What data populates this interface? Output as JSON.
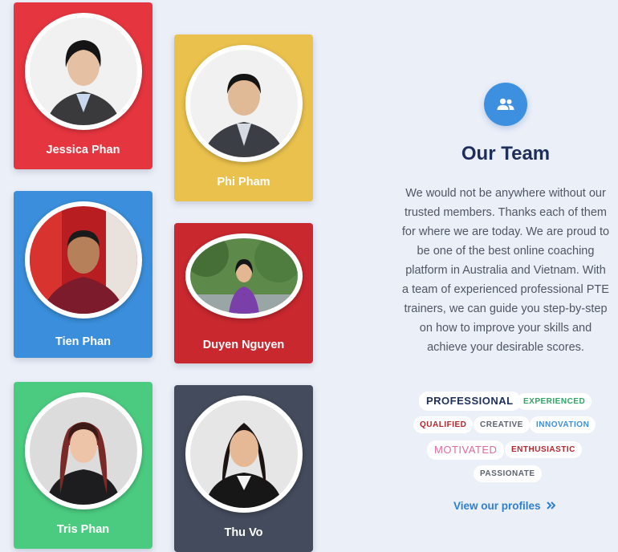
{
  "members": [
    {
      "name": "Jessica Phan",
      "color": "#e5353f"
    },
    {
      "name": "Phi Pham",
      "color": "#eac14c"
    },
    {
      "name": "Tien Phan",
      "color": "#3a8edb"
    },
    {
      "name": "Duyen Nguyen",
      "color": "#c8282e"
    },
    {
      "name": "Tris Phan",
      "color": "#4bcb80"
    },
    {
      "name": "Thu Vo",
      "color": "#434b5c"
    }
  ],
  "team": {
    "icon": "users-icon",
    "title": "Our Team",
    "description": "We would not be anywhere without our trusted members. Thanks each of them for where we are today. We are proud to be one of the best online coaching platform in Australia and Vietnam. With a team of experienced professional PTE trainers, we can guide you step-by-step on how to improve your skills and achieve your desirable scores.",
    "tags": [
      {
        "label": "PROFESSIONAL",
        "color": "#1e2f5c"
      },
      {
        "label": "EXPERIENCED",
        "color": "#2fa565"
      },
      {
        "label": "QUALIFIED",
        "color": "#b3262d"
      },
      {
        "label": "CREATIVE",
        "color": "#5c6370"
      },
      {
        "label": "INNOVATION",
        "color": "#3a8edb"
      },
      {
        "label": "MOTIVATED",
        "color": "#e06aa0"
      },
      {
        "label": "ENTHUSIASTIC",
        "color": "#b3262d"
      },
      {
        "label": "PASSIONATE",
        "color": "#5c6370"
      }
    ],
    "link_label": "View our profiles",
    "link_icon": "double-chevron-right-icon"
  }
}
